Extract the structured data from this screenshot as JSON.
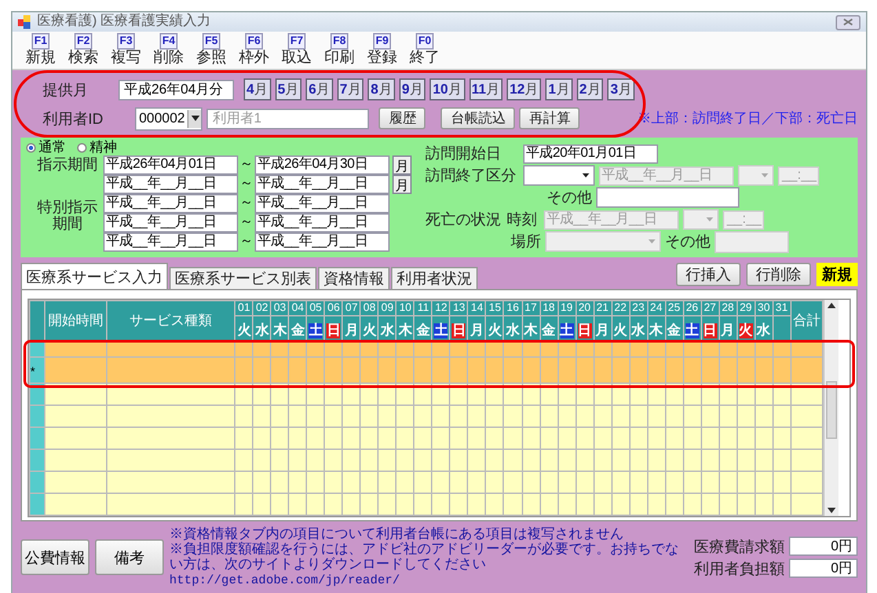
{
  "window": {
    "title": "医療看護) 医療看護実績入力"
  },
  "toolbar": [
    {
      "key": "F1",
      "label": "新規"
    },
    {
      "key": "F2",
      "label": "検索"
    },
    {
      "key": "F3",
      "label": "複写"
    },
    {
      "key": "F4",
      "label": "削除"
    },
    {
      "key": "F5",
      "label": "参照"
    },
    {
      "key": "F6",
      "label": "枠外"
    },
    {
      "key": "F7",
      "label": "取込"
    },
    {
      "key": "F8",
      "label": "印刷"
    },
    {
      "key": "F9",
      "label": "登録"
    },
    {
      "key": "F0",
      "label": "終了"
    }
  ],
  "provision": {
    "label": "提供月",
    "value": "平成26年04月分",
    "months": [
      {
        "num": "4",
        "unit": "月"
      },
      {
        "num": "5",
        "unit": "月"
      },
      {
        "num": "6",
        "unit": "月"
      },
      {
        "num": "7",
        "unit": "月"
      },
      {
        "num": "8",
        "unit": "月"
      },
      {
        "num": "9",
        "unit": "月"
      },
      {
        "num": "10",
        "unit": "月"
      },
      {
        "num": "11",
        "unit": "月"
      },
      {
        "num": "12",
        "unit": "月"
      },
      {
        "num": "1",
        "unit": "月"
      },
      {
        "num": "2",
        "unit": "月"
      },
      {
        "num": "3",
        "unit": "月"
      }
    ]
  },
  "user": {
    "label": "利用者ID",
    "id": "000002",
    "placeholder": "利用者1",
    "buttons": [
      "履歴",
      "台帳読込",
      "再計算"
    ],
    "note": "※上部：訪問終了日／下部：死亡日"
  },
  "mode": [
    {
      "label": "通常",
      "selected": true
    },
    {
      "label": "精神",
      "selected": false
    }
  ],
  "instruction": {
    "label": "指示期間",
    "rows": [
      {
        "from": "平成26年04月01日",
        "to": "平成26年04月30日",
        "button": "月"
      },
      {
        "from": "平成__年__月__日",
        "to": "平成__年__月__日",
        "button": "月"
      }
    ]
  },
  "special": {
    "label": "特別指示期間",
    "rows": [
      {
        "from": "平成__年__月__日",
        "to": "平成__年__月__日"
      },
      {
        "from": "平成__年__月__日",
        "to": "平成__年__月__日"
      },
      {
        "from": "平成__年__月__日",
        "to": "平成__年__月__日"
      }
    ]
  },
  "range_separator": "～",
  "visit": {
    "start_label": "訪問開始日",
    "start": "平成20年01月01日",
    "end_label": "訪問終了区分",
    "end_date": "平成__年__月__日",
    "end_time": "__:__",
    "other_label": "その他"
  },
  "death": {
    "label": "死亡の状況",
    "time_label": "時刻",
    "date": "平成__年__月__日",
    "time": "__:__",
    "place_label": "場所",
    "other_label": "その他"
  },
  "tabs": [
    {
      "label": "医療系サービス入力",
      "selected": true
    },
    {
      "label": "医療系サービス別表",
      "selected": false
    },
    {
      "label": "資格情報",
      "selected": false
    },
    {
      "label": "利用者状況",
      "selected": false
    }
  ],
  "actions": [
    "行挿入",
    "行削除"
  ],
  "status": "新規",
  "grid": {
    "columns": [
      "開始時間",
      "サービス種類"
    ],
    "total": "合計",
    "days": [
      {
        "num": "01",
        "dow": "火",
        "kind": "weekday"
      },
      {
        "num": "02",
        "dow": "水",
        "kind": "weekday"
      },
      {
        "num": "03",
        "dow": "木",
        "kind": "weekday"
      },
      {
        "num": "04",
        "dow": "金",
        "kind": "weekday"
      },
      {
        "num": "05",
        "dow": "土",
        "kind": "saturday"
      },
      {
        "num": "06",
        "dow": "日",
        "kind": "holiday"
      },
      {
        "num": "07",
        "dow": "月",
        "kind": "weekday"
      },
      {
        "num": "08",
        "dow": "火",
        "kind": "weekday"
      },
      {
        "num": "09",
        "dow": "水",
        "kind": "weekday"
      },
      {
        "num": "10",
        "dow": "木",
        "kind": "weekday"
      },
      {
        "num": "11",
        "dow": "金",
        "kind": "weekday"
      },
      {
        "num": "12",
        "dow": "土",
        "kind": "saturday"
      },
      {
        "num": "13",
        "dow": "日",
        "kind": "holiday"
      },
      {
        "num": "14",
        "dow": "月",
        "kind": "weekday"
      },
      {
        "num": "15",
        "dow": "火",
        "kind": "weekday"
      },
      {
        "num": "16",
        "dow": "水",
        "kind": "weekday"
      },
      {
        "num": "17",
        "dow": "木",
        "kind": "weekday"
      },
      {
        "num": "18",
        "dow": "金",
        "kind": "weekday"
      },
      {
        "num": "19",
        "dow": "土",
        "kind": "saturday"
      },
      {
        "num": "20",
        "dow": "日",
        "kind": "holiday"
      },
      {
        "num": "21",
        "dow": "月",
        "kind": "weekday"
      },
      {
        "num": "22",
        "dow": "火",
        "kind": "weekday"
      },
      {
        "num": "23",
        "dow": "水",
        "kind": "weekday"
      },
      {
        "num": "24",
        "dow": "木",
        "kind": "weekday"
      },
      {
        "num": "25",
        "dow": "金",
        "kind": "weekday"
      },
      {
        "num": "26",
        "dow": "土",
        "kind": "saturday"
      },
      {
        "num": "27",
        "dow": "日",
        "kind": "holiday"
      },
      {
        "num": "28",
        "dow": "月",
        "kind": "weekday"
      },
      {
        "num": "29",
        "dow": "火",
        "kind": "holiday"
      },
      {
        "num": "30",
        "dow": "水",
        "kind": "weekday"
      },
      {
        "num": "31"
      }
    ],
    "rows": [
      {
        "highlighted": true
      },
      {
        "highlighted": true,
        "marker": "*"
      },
      {
        "highlighted": false
      },
      {
        "highlighted": false
      },
      {
        "highlighted": false
      },
      {
        "highlighted": false
      },
      {
        "highlighted": false
      },
      {
        "highlighted": false
      }
    ]
  },
  "footer": {
    "buttons": [
      "公費情報",
      "備考"
    ],
    "notes": [
      "※資格情報タブ内の項目について利用者台帳にある項目は複写されません",
      "※負担限度額確認を行うには、アドビ社のアドビリーダーが必要です。お持ちでない方は、次のサイトよりダウンロードしてください"
    ],
    "link": "http://get.adobe.com/jp/reader/",
    "totals": [
      {
        "label": "医療費請求額",
        "value": "0円"
      },
      {
        "label": "利用者負担額",
        "value": "0円"
      }
    ]
  },
  "markup": {
    "header_circled": true,
    "rows_boxed": true
  }
}
